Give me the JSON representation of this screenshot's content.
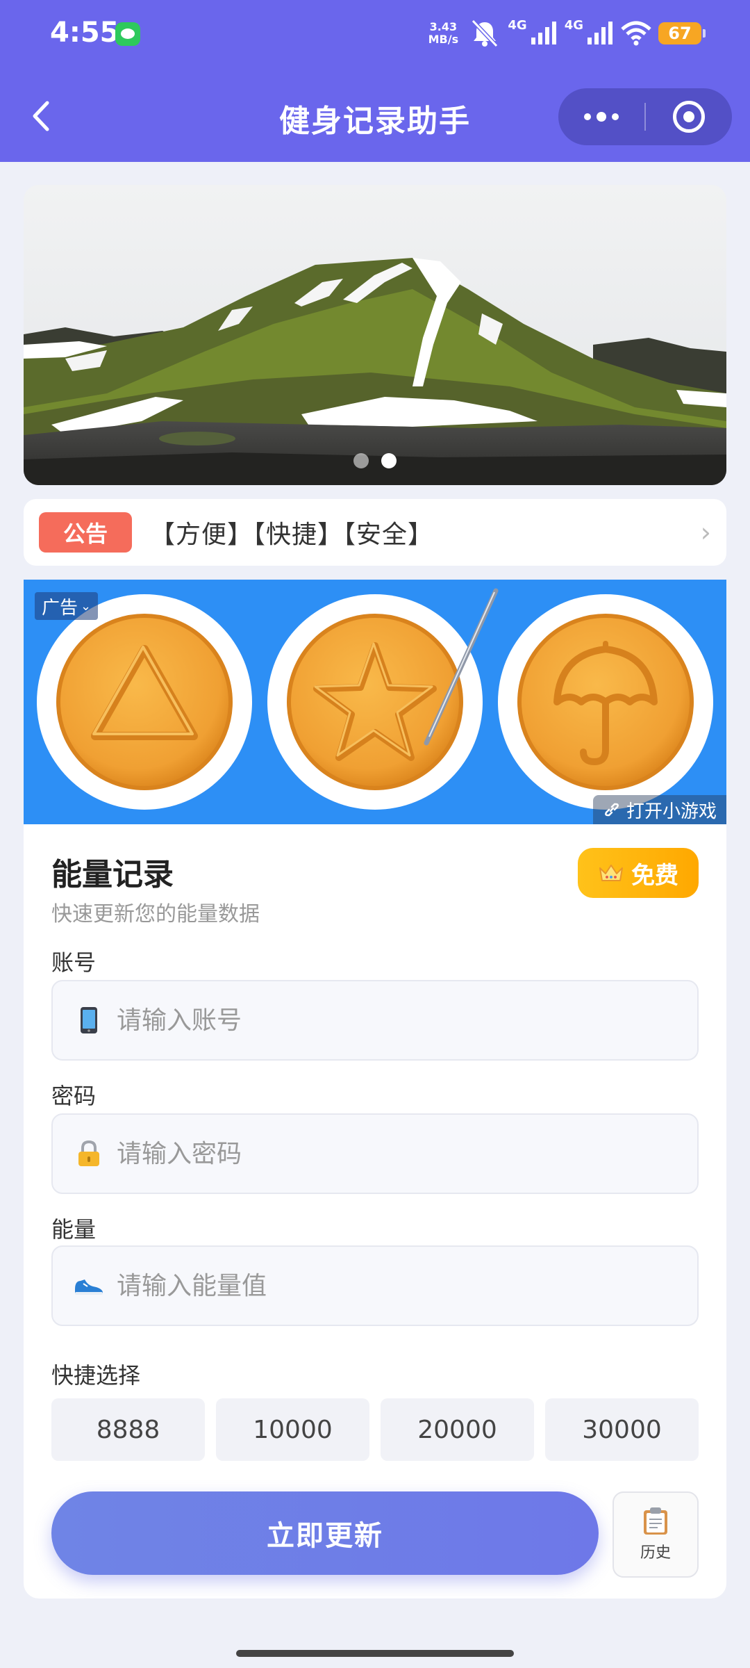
{
  "status_bar": {
    "time": "4:55",
    "net_speed_value": "3.43",
    "net_speed_unit": "MB/s",
    "network_1": "4G",
    "network_2": "4G",
    "battery": "67"
  },
  "nav": {
    "title": "健身记录助手"
  },
  "banner": {
    "slide_count": 2,
    "active_slide": 2
  },
  "notice": {
    "badge": "公告",
    "text": "【方便】【快捷】【安全】",
    "chevron": "›"
  },
  "ad": {
    "tag": "广告",
    "open_label": "打开小游戏"
  },
  "form": {
    "title": "能量记录",
    "subtitle": "快速更新您的能量数据",
    "free_badge": "免费",
    "account": {
      "label": "账号",
      "placeholder": "请输入账号",
      "icon": "phone-icon"
    },
    "password": {
      "label": "密码",
      "placeholder": "请输入密码",
      "icon": "lock-icon"
    },
    "energy": {
      "label": "能量",
      "placeholder": "请输入能量值",
      "icon": "shoe-icon"
    },
    "quick_label": "快捷选择",
    "quick_options": [
      "8888",
      "10000",
      "20000",
      "30000"
    ],
    "submit_label": "立即更新",
    "history_label": "历史"
  },
  "colors": {
    "header": "#6a66ec",
    "accent": "#6e7ce8",
    "notice_badge": "#f56c5b",
    "free_badge": "#ffb40f",
    "ad_background": "#2d8ff5"
  }
}
